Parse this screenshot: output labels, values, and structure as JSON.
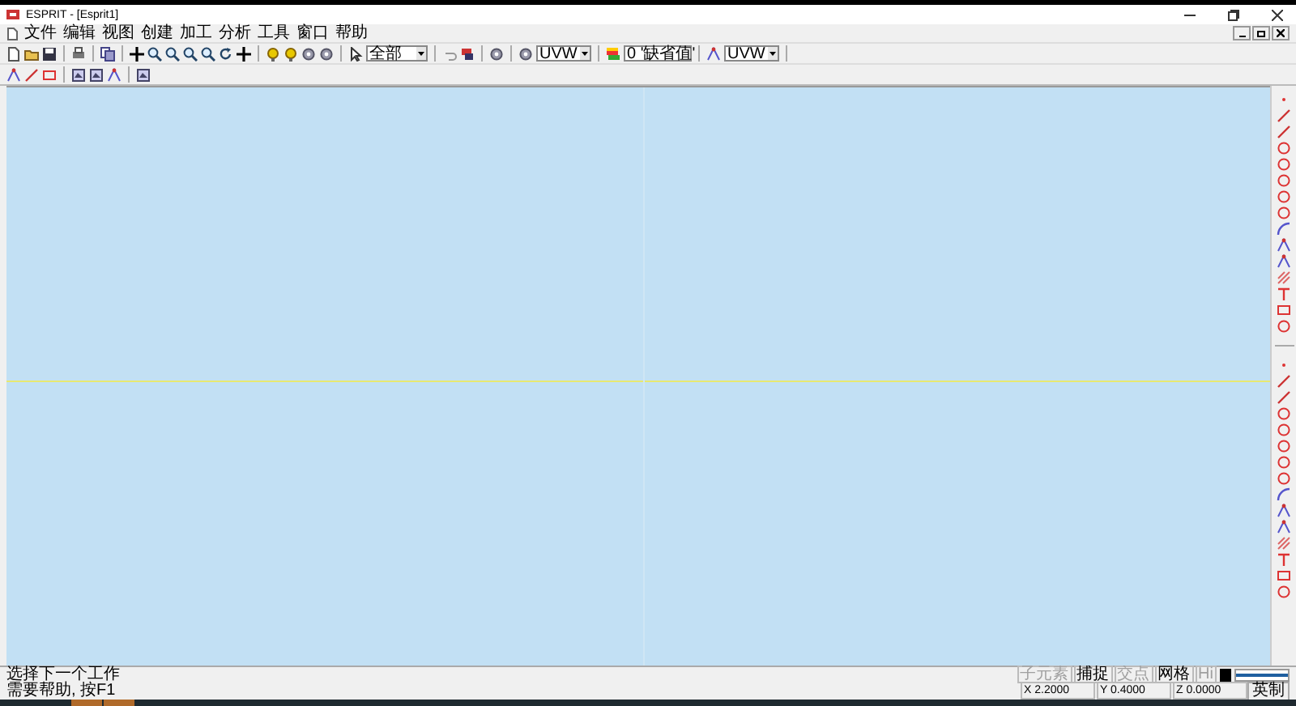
{
  "window": {
    "title": "ESPRIT - [Esprit1]"
  },
  "menu": [
    "文件",
    "编辑",
    "视图",
    "创建",
    "加工",
    "分析",
    "工具",
    "窗口",
    "帮助"
  ],
  "toolbar": {
    "combos": [
      {
        "value": "全部"
      },
      {
        "value": "UVW"
      },
      {
        "value": "0 '缺省值'"
      },
      {
        "value": "UVW"
      }
    ]
  },
  "status_bar": {
    "message": "选择下一个工作",
    "help": "需要帮助, 按F1",
    "toggles": [
      {
        "label": "子元素",
        "disabled": true
      },
      {
        "label": "捕捉",
        "disabled": false
      },
      {
        "label": "交点",
        "disabled": true
      },
      {
        "label": "网格",
        "disabled": false
      },
      {
        "label": "Hi",
        "disabled": true
      }
    ],
    "coords": [
      {
        "label": "X 2.2000"
      },
      {
        "label": "Y 0.4000"
      },
      {
        "label": "Z 0.0000"
      }
    ],
    "units": "英制"
  }
}
